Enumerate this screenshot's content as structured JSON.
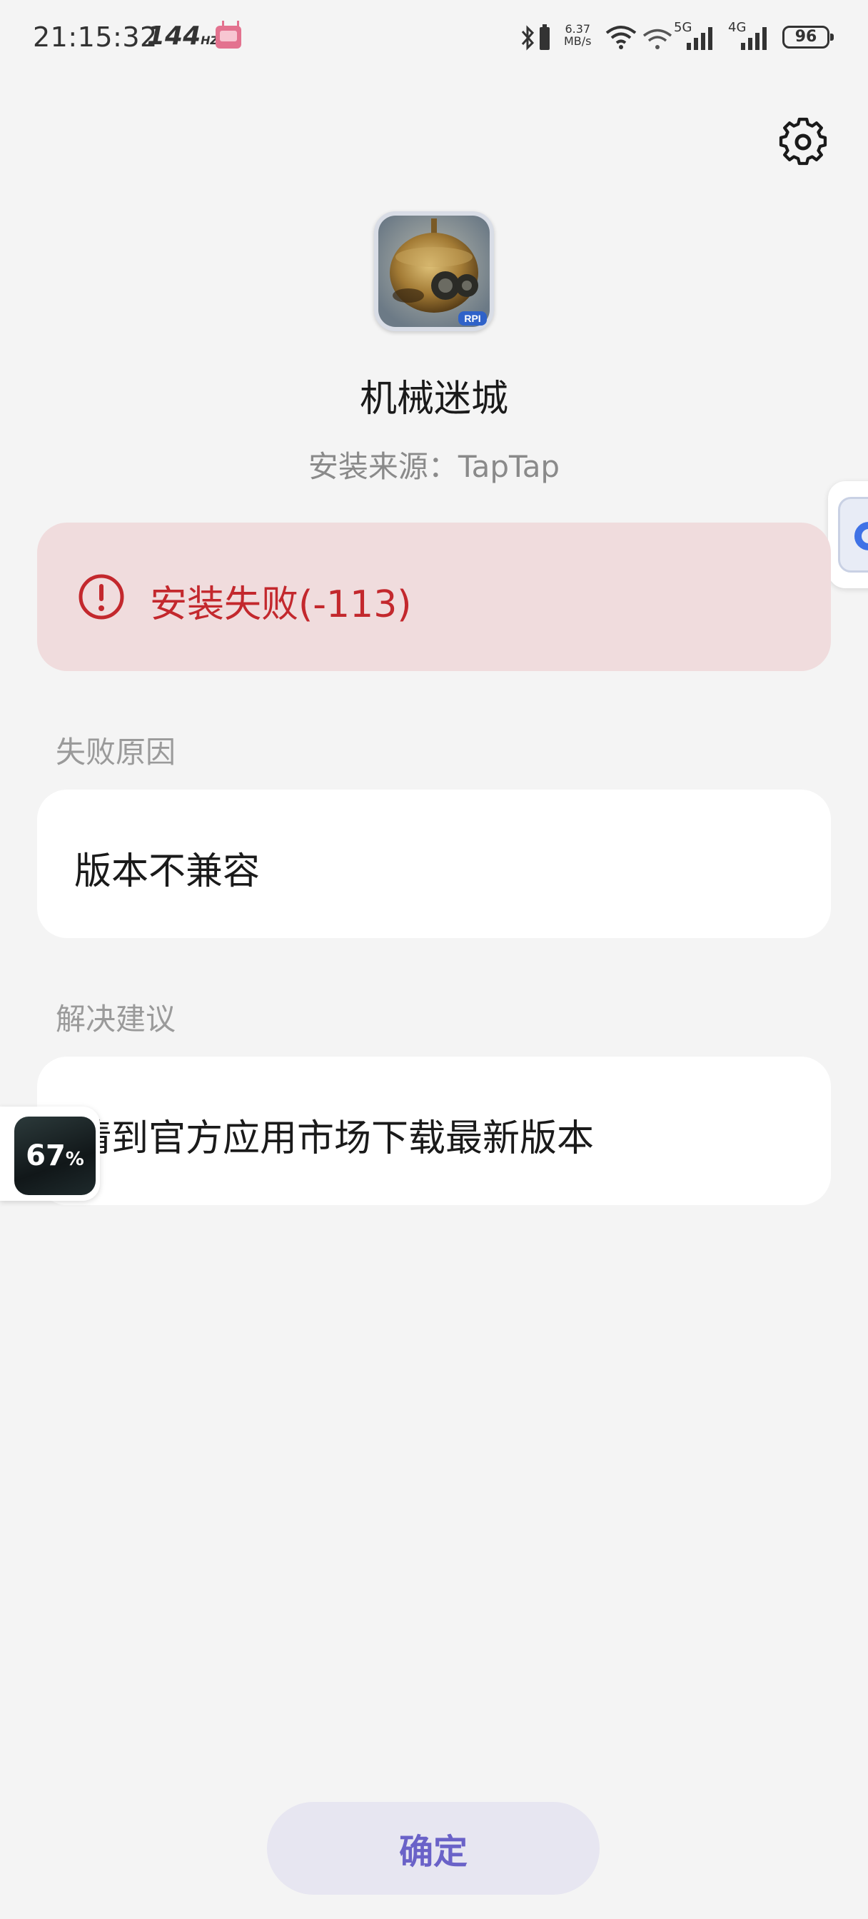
{
  "status_bar": {
    "time": "21:15:32",
    "refresh_rate": "144",
    "refresh_unit": "HZ",
    "net_speed_value": "6.37",
    "net_speed_unit": "MB/s",
    "network_5g": "5G",
    "network_4g": "4G",
    "battery": "96",
    "icons": [
      "tv-icon",
      "bluetooth-icon",
      "wifi-icon",
      "wifi-icon-2",
      "signal-icon",
      "signal-icon-2",
      "battery-icon"
    ]
  },
  "app": {
    "name": "机械迷城",
    "source": "安装来源：TapTap",
    "icon": "robot-icon",
    "icon_badge": "RPI"
  },
  "error": {
    "text": "安装失败(-113)",
    "icon": "alert-circle-icon",
    "color": "#c3282d",
    "background": "#f0dcdd"
  },
  "sections": {
    "reason_label": "失败原因",
    "reason_text": "版本不兼容",
    "suggestion_label": "解决建议",
    "suggestion_text": "请到官方应用市场下载最新版本"
  },
  "floating_progress": {
    "value": "67",
    "unit": "%"
  },
  "actions": {
    "confirm_label": "确定",
    "accent": "#6a62c8"
  }
}
